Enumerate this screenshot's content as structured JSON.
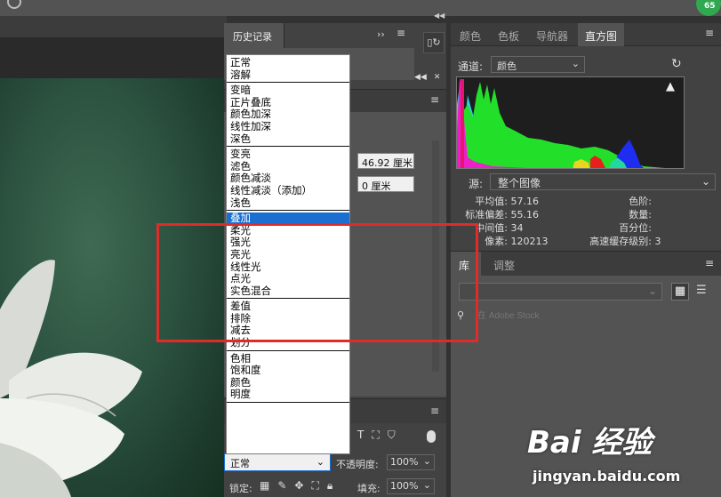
{
  "avatar": {
    "text": "65"
  },
  "history_panel": {
    "tab": "历史记录",
    "expand": "››"
  },
  "properties": {
    "width_value": "46.92 厘米",
    "offset_value": "0 厘米"
  },
  "blend_modes": {
    "groups": [
      [
        "正常",
        "溶解"
      ],
      [
        "变暗",
        "正片叠底",
        "颜色加深",
        "线性加深",
        "深色"
      ],
      [
        "变亮",
        "滤色",
        "颜色减淡",
        "线性减淡（添加）",
        "浅色"
      ],
      [
        "叠加",
        "柔光",
        "强光",
        "亮光",
        "线性光",
        "点光",
        "实色混合"
      ],
      [
        "差值",
        "排除",
        "减去",
        "划分"
      ],
      [
        "色相",
        "饱和度",
        "颜色",
        "明度"
      ]
    ],
    "selected": "叠加"
  },
  "layers": {
    "blend_mode": "正常",
    "opacity_label": "不透明度:",
    "opacity_value": "100%",
    "lock_label": "锁定:",
    "fill_label": "填充:",
    "fill_value": "100%",
    "filter_icons": [
      "text-filter-icon",
      "shape-filter-icon",
      "smart-object-filter-icon"
    ]
  },
  "right_panel": {
    "tabs": [
      "颜色",
      "色板",
      "导航器",
      "直方图"
    ],
    "active_tab": "直方图",
    "channel_label": "通道:",
    "channel_value": "颜色",
    "source_label": "源:",
    "source_value": "整个图像",
    "stats_left": [
      {
        "label": "平均值:",
        "value": "57.16"
      },
      {
        "label": "标准偏差:",
        "value": "55.16"
      },
      {
        "label": "中间值:",
        "value": "34"
      },
      {
        "label": "像素:",
        "value": "120213"
      }
    ],
    "stats_right": [
      {
        "label": "色阶:",
        "value": ""
      },
      {
        "label": "数量:",
        "value": ""
      },
      {
        "label": "百分位:",
        "value": ""
      },
      {
        "label": "高速缓存级别:",
        "value": "3"
      }
    ],
    "library_tabs": [
      "库",
      "调整"
    ],
    "search_placeholder": "在 Adobe Stock"
  },
  "watermark": {
    "logo": "Bai 经验",
    "url": "jingyan.baidu.com"
  },
  "colors": {
    "highlight": "#e02b2b",
    "selected_row": "#1a6fd0",
    "panel": "#535353"
  }
}
